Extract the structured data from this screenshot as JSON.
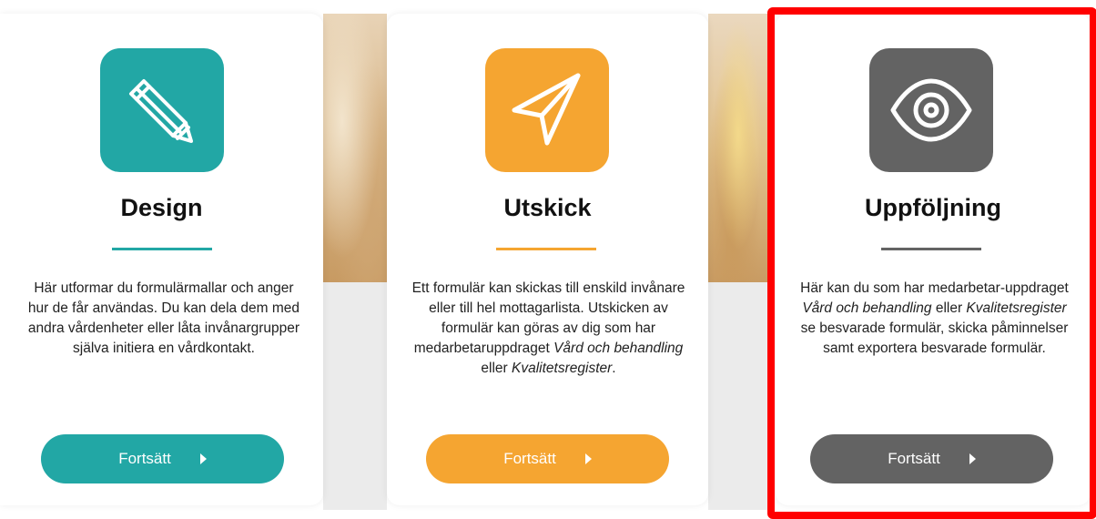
{
  "colors": {
    "design": "#22a7a5",
    "utskick": "#f5a531",
    "uppfoljning": "#636363",
    "highlight": "#ff0000"
  },
  "cards": [
    {
      "title": "Design",
      "icon": "pencil-icon",
      "text_segments": [
        "Här utformar du formulärmallar och anger hur de får användas. Du kan dela dem med andra vårdenheter eller låta invånargrupper själva initiera en vårdkontakt."
      ],
      "button_label": "Fortsätt",
      "button_icon": "caret-right-icon"
    },
    {
      "title": "Utskick",
      "icon": "paper-plane-icon",
      "text_segments": [
        "Ett formulär kan skickas till enskild invånare eller till hel mottagarlista. Utskicken av formulär kan göras av dig som har medarbetaruppdraget ",
        "Vård och behandling",
        " eller ",
        "Kvalitetsregister",
        "."
      ],
      "button_label": "Fortsätt",
      "button_icon": "caret-right-icon"
    },
    {
      "title": "Uppföljning",
      "icon": "eye-icon",
      "text_segments": [
        "Här kan du som har medarbetar-uppdraget ",
        "Vård och behandling",
        " eller ",
        "Kvalitetsregister",
        " se besvarade formulär, skicka påminnelser samt exportera besvarade formulär."
      ],
      "button_label": "Fortsätt",
      "button_icon": "caret-right-icon"
    }
  ]
}
